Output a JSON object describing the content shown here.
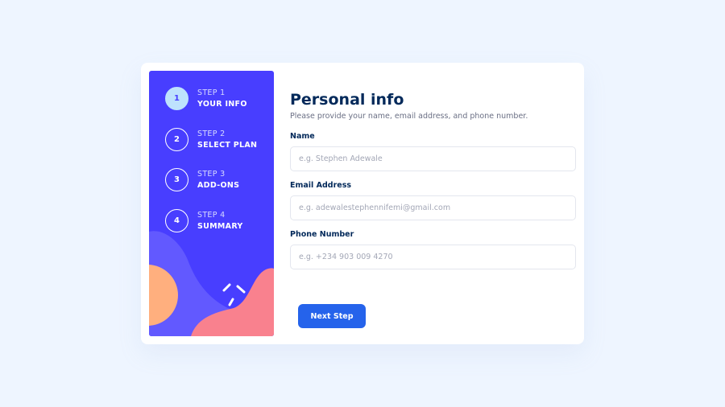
{
  "sidebar": {
    "steps": [
      {
        "num": "1",
        "label": "STEP 1",
        "title": "YOUR INFO"
      },
      {
        "num": "2",
        "label": "STEP 2",
        "title": "SELECT PLAN"
      },
      {
        "num": "3",
        "label": "STEP 3",
        "title": "ADD-ONS"
      },
      {
        "num": "4",
        "label": "STEP 4",
        "title": "SUMMARY"
      }
    ]
  },
  "form": {
    "title": "Personal info",
    "subtitle": "Please provide your name, email address, and phone number.",
    "fields": {
      "name": {
        "label": "Name",
        "placeholder": "e.g. Stephen Adewale"
      },
      "email": {
        "label": "Email Address",
        "placeholder": "e.g. adewalestephennifemi@gmail.com"
      },
      "phone": {
        "label": "Phone Number",
        "placeholder": "e.g. +234 903 009 4270"
      }
    },
    "next_label": "Next Step"
  },
  "colors": {
    "sidebar": "#483eff",
    "active_step": "#bee2fd",
    "button": "#2563eb",
    "heading": "#02295a",
    "background": "#eef5ff"
  }
}
